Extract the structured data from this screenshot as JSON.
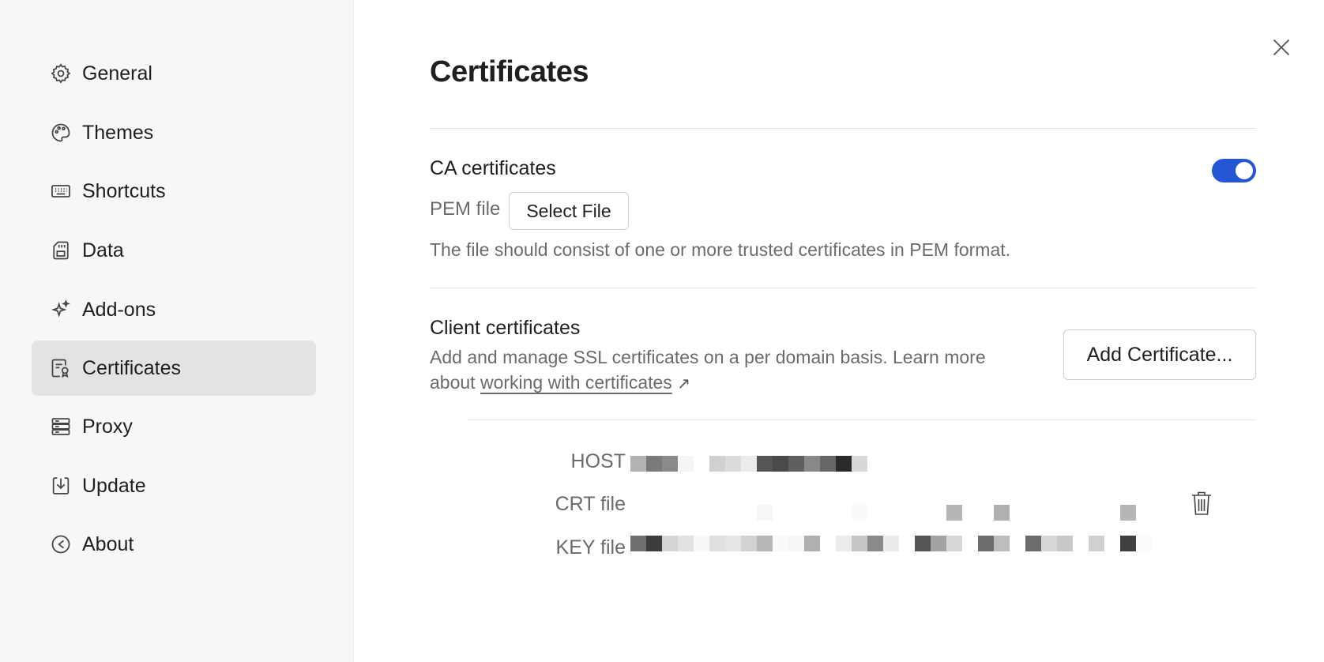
{
  "sidebar": {
    "items": [
      {
        "label": "General",
        "icon": "gear-icon"
      },
      {
        "label": "Themes",
        "icon": "palette-icon"
      },
      {
        "label": "Shortcuts",
        "icon": "keyboard-icon"
      },
      {
        "label": "Data",
        "icon": "sd-card-icon"
      },
      {
        "label": "Add-ons",
        "icon": "sparkle-icon"
      },
      {
        "label": "Certificates",
        "icon": "certificate-icon",
        "active": true
      },
      {
        "label": "Proxy",
        "icon": "server-icon"
      },
      {
        "label": "Update",
        "icon": "download-icon"
      },
      {
        "label": "About",
        "icon": "info-circle-icon"
      }
    ]
  },
  "page": {
    "title": "Certificates"
  },
  "ca": {
    "title": "CA certificates",
    "enabled": true,
    "pem_label": "PEM file",
    "select_button": "Select File",
    "description": "The file should consist of one or more trusted certificates in PEM format."
  },
  "client": {
    "title": "Client certificates",
    "description_before": "Add and manage SSL certificates on a per domain basis. Learn more about ",
    "link_text": "working with certificates",
    "link_arrow": "↗",
    "add_button": "Add Certificate...",
    "entry": {
      "host_label": "HOST",
      "crt_label": "CRT file",
      "key_label": "KEY file"
    }
  },
  "colors": {
    "accent": "#2456d6",
    "sidebar_bg": "#f7f7f7",
    "active_item_bg": "#e3e3e3"
  }
}
